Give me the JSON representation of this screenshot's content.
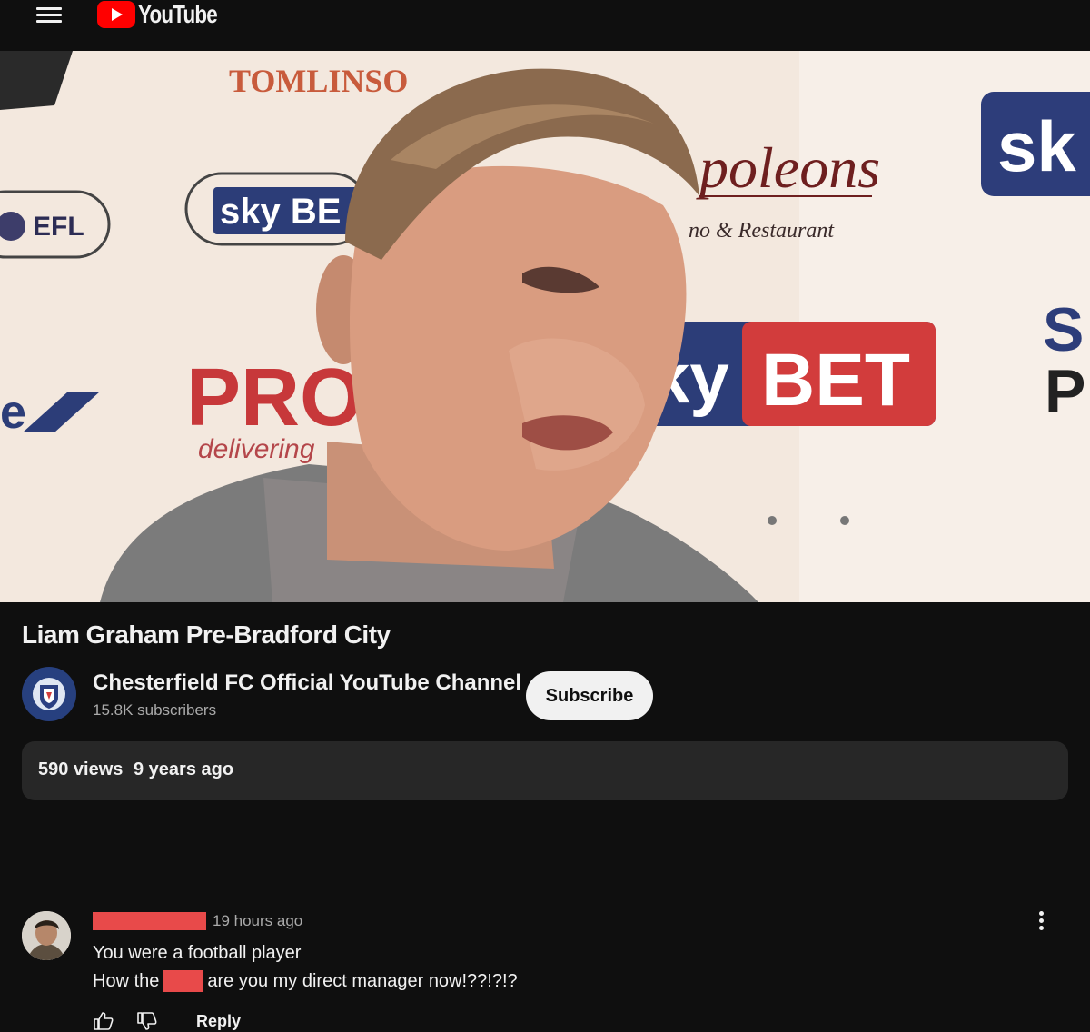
{
  "header": {
    "brand": "YouTube"
  },
  "video": {
    "title": "Liam Graham Pre-Bradford City",
    "backdrop_text": {
      "tomlinson": "TOMLINSO",
      "efl": "EFL",
      "sky_be": "sky BE",
      "poleons": "poleons",
      "restaurant": "no & Restaurant",
      "sk": "sk",
      "pro": "PRO",
      "delivering": "delivering",
      "bet": "BET",
      "ky": "ky",
      "s": "S",
      "p": "P",
      "e": "e"
    }
  },
  "channel": {
    "name": "Chesterfield FC Official YouTube Channel",
    "subscribers": "15.8K subscribers",
    "subscribe_label": "Subscribe"
  },
  "description": {
    "views": "590 views",
    "age": "9 years ago"
  },
  "comment": {
    "time": "19 hours ago",
    "line1": "You were a football player",
    "line2_before": "How the",
    "line2_after": "are you my direct manager now!??!?!?",
    "reply_label": "Reply"
  },
  "colors": {
    "background": "#0f0f0f",
    "surface": "#272727",
    "brand_red": "#ff0000",
    "redaction": "#e84a4a",
    "secondary_text": "#aaaaaa"
  }
}
